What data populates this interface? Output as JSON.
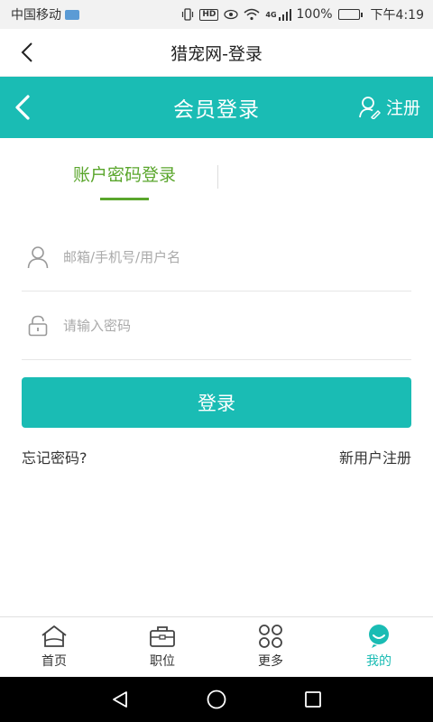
{
  "status_bar": {
    "carrier": "中国移动",
    "hd": "HD",
    "network": "4G",
    "battery": "100%",
    "time": "下午4:19"
  },
  "web_header": {
    "title": "猎宠网-登录"
  },
  "title_bar": {
    "title": "会员登录",
    "register_label": "注册"
  },
  "tabs": {
    "active_label": "账户密码登录"
  },
  "form": {
    "username_placeholder": "邮箱/手机号/用户名",
    "username_value": "",
    "password_placeholder": "请输入密码",
    "password_value": "",
    "login_label": "登录",
    "forgot_label": "忘记密码?",
    "new_user_label": "新用户注册"
  },
  "bottom_nav": {
    "items": [
      {
        "label": "首页",
        "icon": "home-icon"
      },
      {
        "label": "职位",
        "icon": "briefcase-icon"
      },
      {
        "label": "更多",
        "icon": "grid-icon"
      },
      {
        "label": "我的",
        "icon": "profile-icon",
        "active": true
      }
    ]
  },
  "colors": {
    "accent": "#1abcb4",
    "tab_active": "#5aa62c"
  }
}
